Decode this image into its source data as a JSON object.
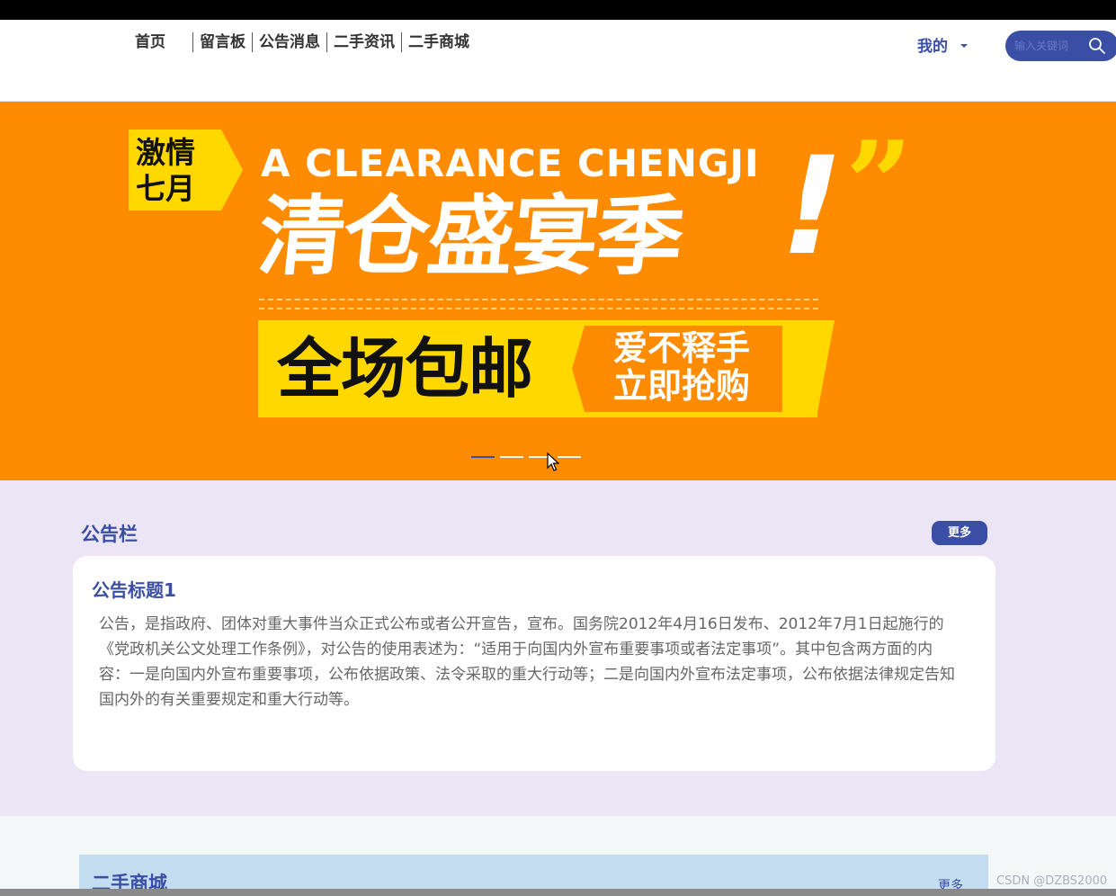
{
  "nav": {
    "items": [
      "首页",
      "留言板",
      "公告消息",
      "二手资讯",
      "二手商城"
    ]
  },
  "user_menu": {
    "label": "我的"
  },
  "search": {
    "placeholder": "输入关键词"
  },
  "banner": {
    "badge": "激情七月",
    "subtitle": "A CLEARANCE CHENGJI",
    "title": "清仓盛宴季",
    "exclamation": "!",
    "quote": "”",
    "promo": "全场包邮",
    "tag": "爱不释手立即抢购",
    "slides": 4,
    "active_slide": 0
  },
  "notice": {
    "section_title": "公告栏",
    "more_label": "更多",
    "card_title": "公告标题1",
    "card_body": "公告，是指政府、团体对重大事件当众正式公布或者公开宣告，宣布。国务院2012年4月16日发布、2012年7月1日起施行的《党政机关公文处理工作条例》，对公告的使用表述为：“适用于向国内外宣布重要事项或者法定事项”。其中包含两方面的内容：一是向国内外宣布重要事项，公布依据政策、法令采取的重大行动等；二是向国内外宣布法定事项，公布依据法律规定告知国内外的有关重要规定和重大行动等。"
  },
  "mall": {
    "section_title": "二手商城",
    "more_label": "更多"
  },
  "watermark": "CSDN @DZBS2000",
  "colors": {
    "primary": "#3a4ea5",
    "banner_bg": "#ff8c00",
    "banner_yellow": "#ffd800",
    "notice_bg": "#ebe5f5"
  }
}
